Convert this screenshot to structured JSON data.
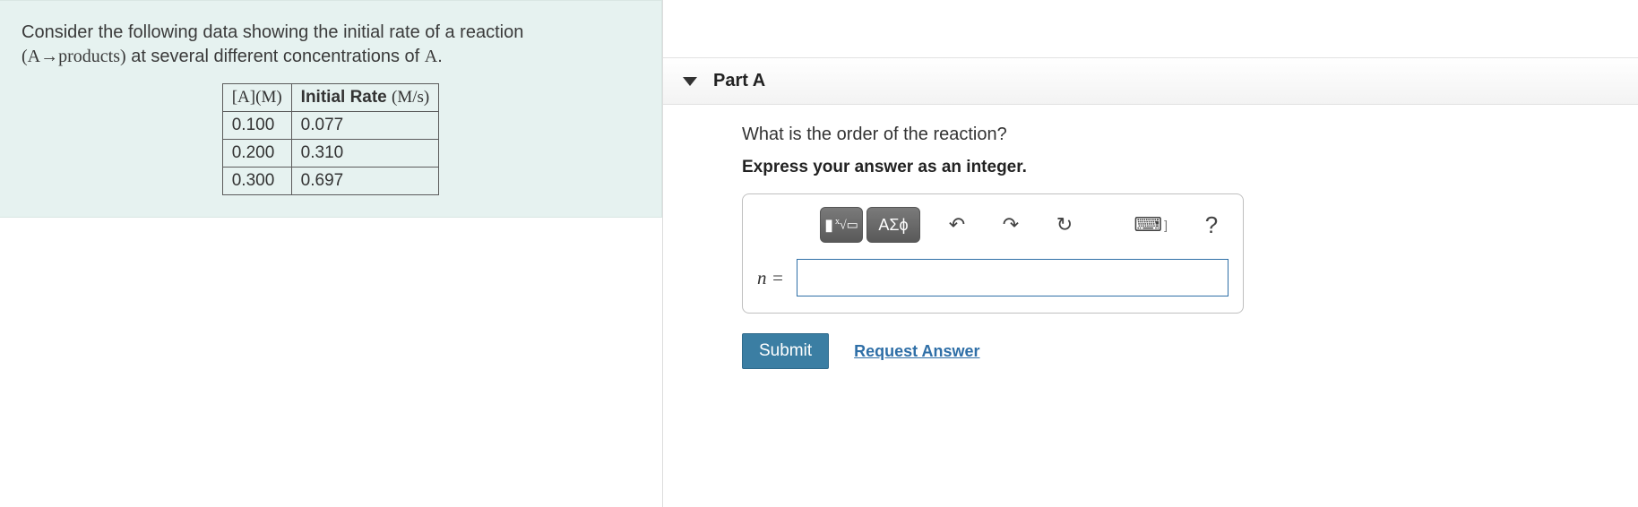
{
  "prompt": {
    "line1": "Consider the following data showing the initial rate of a reaction",
    "reaction": "(A→products)",
    "line2_tail": " at several different concentrations of ",
    "species": "A",
    "period": "."
  },
  "table": {
    "headers": {
      "c1_pre": "[A](",
      "c1_unit": "M",
      "c1_post": ")",
      "c2_pre": "Initial Rate ",
      "c2_unit": "(M/s)"
    },
    "rows": [
      {
        "conc": "0.100",
        "rate": "0.077"
      },
      {
        "conc": "0.200",
        "rate": "0.310"
      },
      {
        "conc": "0.300",
        "rate": "0.697"
      }
    ]
  },
  "part": {
    "label": "Part A",
    "question": "What is the order of the reaction?",
    "instruction": "Express your answer as an integer.",
    "var_label": "n =",
    "input_value": ""
  },
  "toolbar": {
    "template_icon": "▮",
    "sqrt_icon": "√",
    "greek_icon": "ΑΣϕ",
    "undo_icon": "↶",
    "redo_icon": "↷",
    "reset_icon": "↻",
    "keyboard_icon": "⌨",
    "help_icon": "?"
  },
  "actions": {
    "submit": "Submit",
    "request": "Request Answer"
  }
}
